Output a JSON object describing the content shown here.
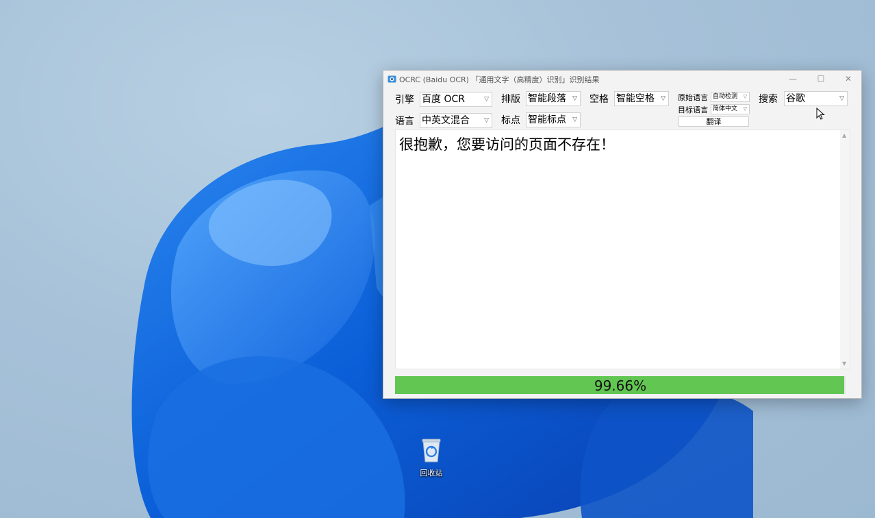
{
  "window": {
    "title": "OCRC (Baidu OCR) 「通用文字（高精度）识别」识别结果",
    "minimize_glyph": "—",
    "maximize_glyph": "☐",
    "close_glyph": "✕"
  },
  "settings": {
    "engine_label": "引擎",
    "engine_value": "百度 OCR",
    "layout_label": "排版",
    "layout_value": "智能段落",
    "space_label": "空格",
    "space_value": "智能空格",
    "language_label": "语言",
    "language_value": "中英文混合",
    "punct_label": "标点",
    "punct_value": "智能标点"
  },
  "translate": {
    "source_label": "原始语言",
    "source_value": "自动检测",
    "target_label": "目标语言",
    "target_value": "简体中文",
    "button_label": "翻译"
  },
  "search": {
    "label": "搜索",
    "value": "谷歌"
  },
  "result": {
    "text": "很抱歉，您要访问的页面不存在！"
  },
  "progress": {
    "value": 0.9966,
    "text": "99.66%",
    "color": "#62c653"
  },
  "desktop": {
    "recycle_bin_label": "回收站"
  },
  "icons": {
    "dropdown": "chevron-down-icon",
    "scroll_up": "scroll-up-arrow-icon",
    "scroll_down": "scroll-down-arrow-icon"
  },
  "colors": {
    "accent_wallpaper": "#1a6fe0",
    "window_bg": "#f3f3f3"
  }
}
